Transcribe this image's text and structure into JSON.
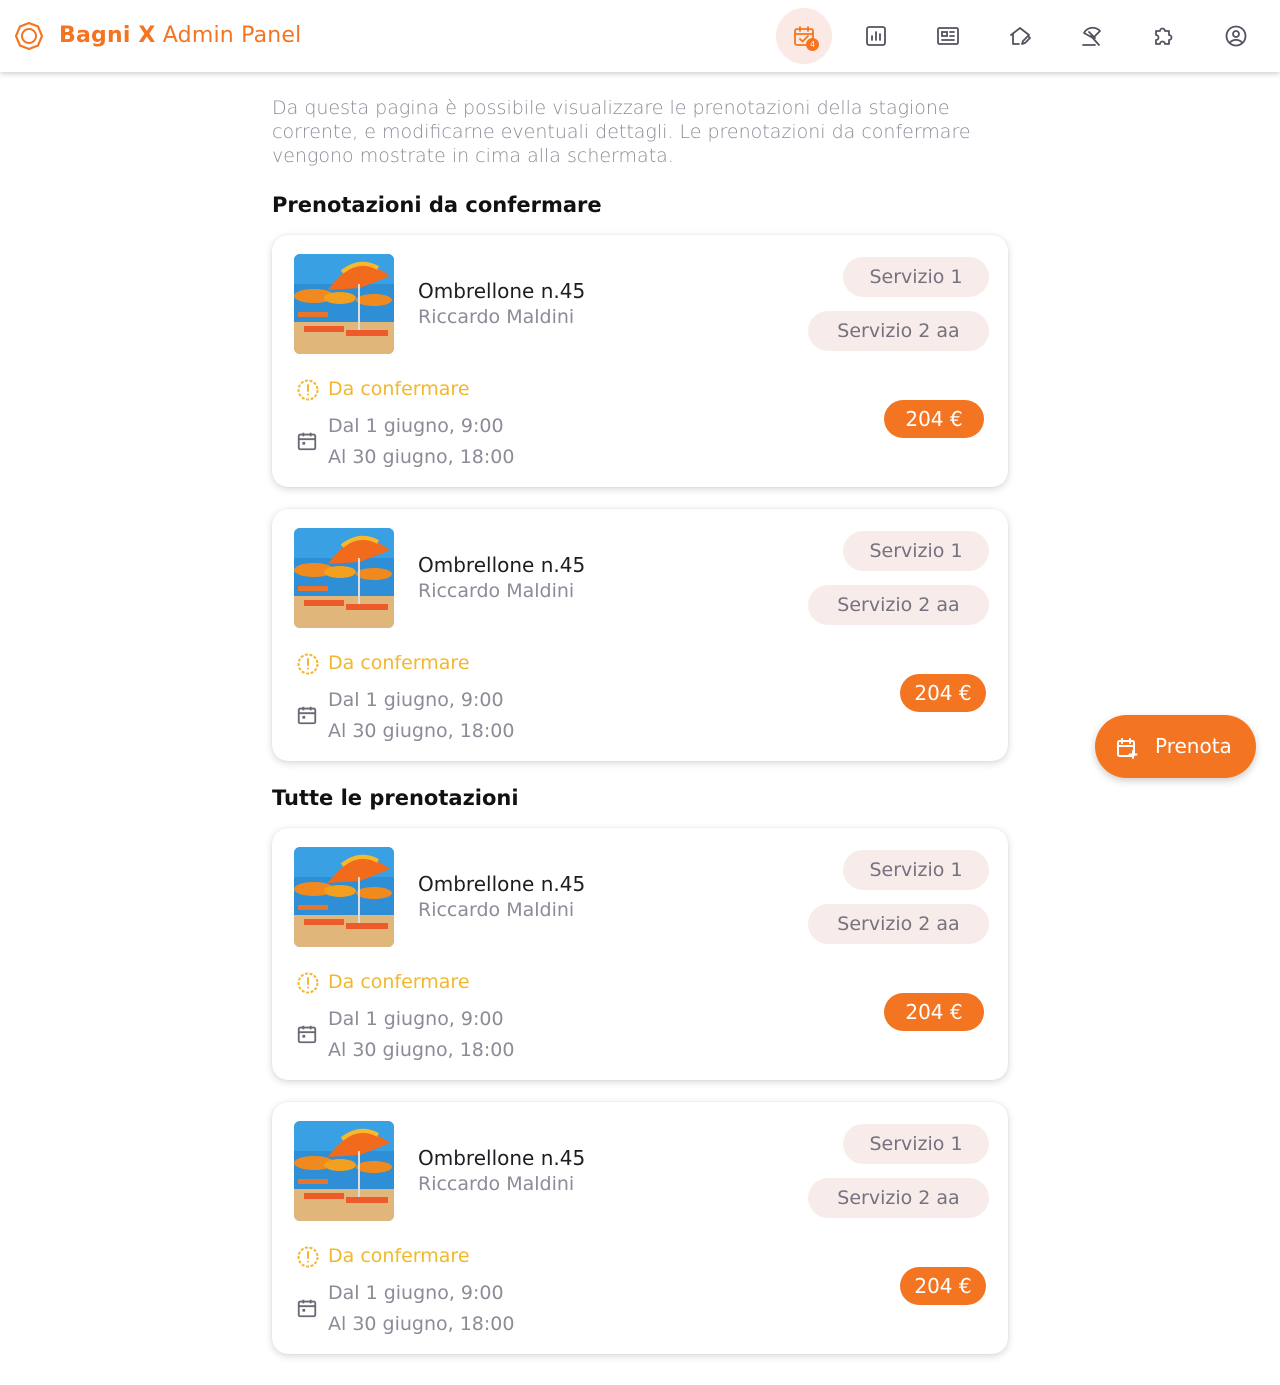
{
  "header": {
    "brand_bold": "Bagni X",
    "brand_rest": " Admin Panel",
    "nav": [
      {
        "icon": "calendar-check-icon",
        "badge": "4",
        "active": true
      },
      {
        "icon": "bar-chart-icon"
      },
      {
        "icon": "newspaper-icon"
      },
      {
        "icon": "house-edit-icon"
      },
      {
        "icon": "beach-umbrella-icon"
      },
      {
        "icon": "puzzle-icon"
      },
      {
        "icon": "account-circle-icon"
      }
    ]
  },
  "intro": "Da questa pagina è possibile visualizzare le prenotazioni della stagione corrente, e modificarne eventuali dettagli. Le prenotazioni da confermare vengono mostrate in cima alla schermata.",
  "sections": [
    {
      "title": "Prenotazioni da confermare",
      "bookings": [
        {
          "title": "Ombrellone n.45",
          "customer": "Riccardo Maldini",
          "services": [
            "Servizio 1",
            "Servizio 2 aa"
          ],
          "status": "Da confermare",
          "from": "Dal 1 giugno, 9:00",
          "to": "Al 30 giugno, 18:00",
          "price": "204 €"
        },
        {
          "title": "Ombrellone n.45",
          "customer": "Riccardo Maldini",
          "services": [
            "Servizio 1",
            "Servizio 2 aa"
          ],
          "status": "Da confermare",
          "from": "Dal 1 giugno, 9:00",
          "to": "Al 30 giugno, 18:00",
          "price": "204 €"
        }
      ]
    },
    {
      "title": "Tutte le prenotazioni",
      "bookings": [
        {
          "title": "Ombrellone n.45",
          "customer": "Riccardo Maldini",
          "services": [
            "Servizio 1",
            "Servizio 2 aa"
          ],
          "status": "Da confermare",
          "from": "Dal 1 giugno, 9:00",
          "to": "Al 30 giugno, 18:00",
          "price": "204 €"
        },
        {
          "title": "Ombrellone n.45",
          "customer": "Riccardo Maldini",
          "services": [
            "Servizio 1",
            "Servizio 2 aa"
          ],
          "status": "Da confermare",
          "from": "Dal 1 giugno, 9:00",
          "to": "Al 30 giugno, 18:00",
          "price": "204 €"
        }
      ]
    }
  ],
  "fab": {
    "label": "Prenota",
    "icon": "calendar-plus-icon"
  },
  "colors": {
    "accent": "#f47521",
    "warning": "#f1b82d",
    "chip_bg": "#f8eceb",
    "muted_text": "#8e8a97"
  }
}
